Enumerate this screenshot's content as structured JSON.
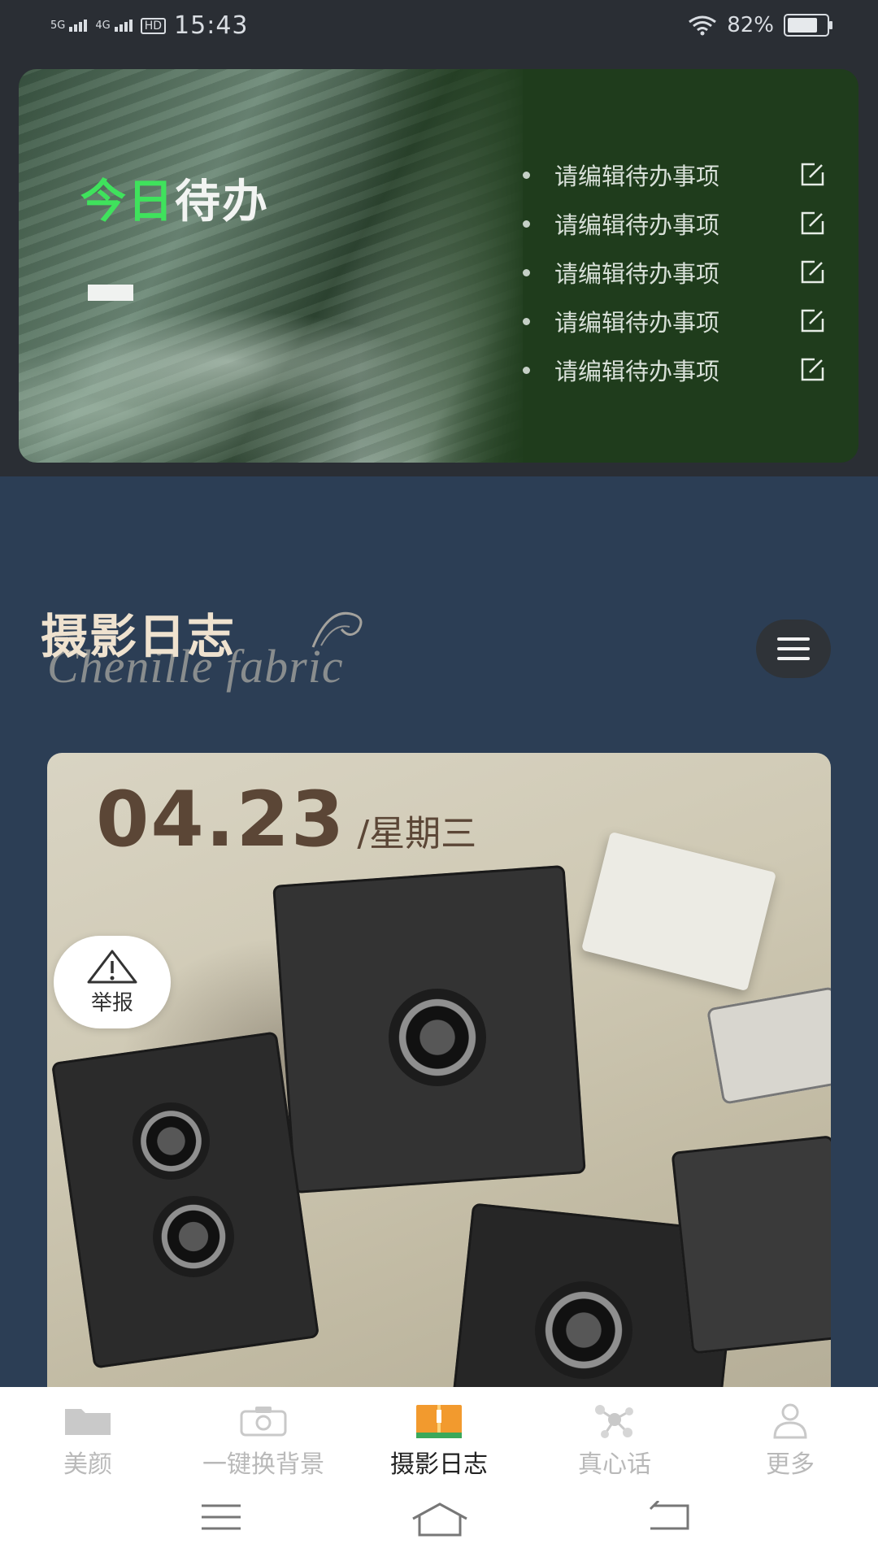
{
  "status_bar": {
    "signal1": "5G",
    "signal2": "4G",
    "hd": "HD",
    "time": "15:43",
    "battery_text": "82%",
    "battery_level": 0.82
  },
  "todo": {
    "title_part1": "今日",
    "title_part2": "待办",
    "items": [
      "请编辑待办事项",
      "请编辑待办事项",
      "请编辑待办事项",
      "请编辑待办事项",
      "请编辑待办事项"
    ]
  },
  "journal": {
    "title": "摄影日志",
    "script_text": "Chenille fabric"
  },
  "photo_card": {
    "date": "04.23",
    "weekday": "/星期三"
  },
  "report": {
    "label": "举报"
  },
  "tabs": [
    {
      "label": "美颜",
      "icon": "folder-icon"
    },
    {
      "label": "一键换背景",
      "icon": "camera-icon"
    },
    {
      "label": "摄影日志",
      "icon": "book-icon"
    },
    {
      "label": "真心话",
      "icon": "molecule-icon"
    },
    {
      "label": "更多",
      "icon": "person-icon"
    }
  ],
  "active_tab": "摄影日志",
  "colors": {
    "background": "#2c3e55",
    "todo_green": "#3fe25c",
    "card_green": "#1f3c1c",
    "date_brown": "#5b4636",
    "active_tab_icon": "#f29a2e"
  }
}
